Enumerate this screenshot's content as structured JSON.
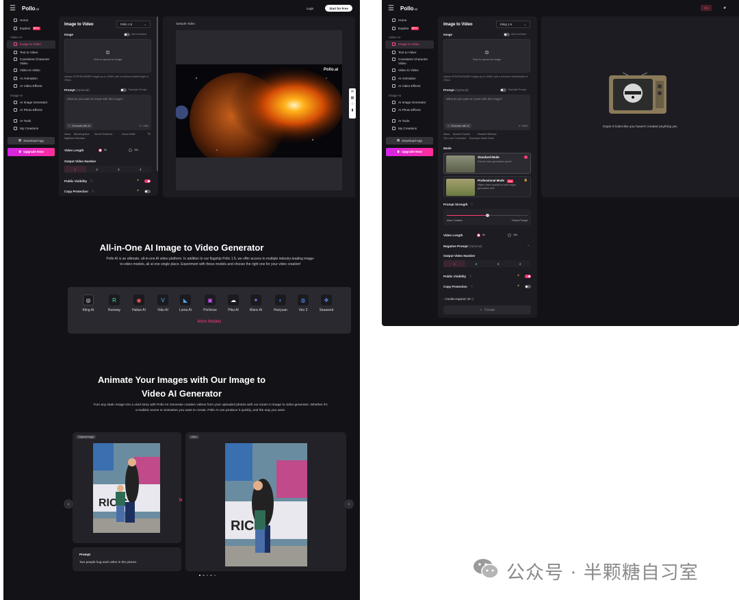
{
  "left": {
    "brand": "Pollo",
    "brand_suffix": ".ai",
    "header": {
      "login": "Login",
      "start": "Start for Free"
    },
    "nav": {
      "home": "Home",
      "explore": "Explore",
      "explore_badge": "BETA",
      "video_ai_section": "Video AI",
      "image_to_video": "Image to Video",
      "text_to_video": "Text to Video",
      "consistent_character": "Consistent Character Video",
      "video_to_video": "Video to Video",
      "ai_animation": "AI Animation",
      "ai_video_effects": "AI Video Effects",
      "image_ai_section": "Image AI",
      "ai_image_generator": "AI Image Generator",
      "ai_photo_effects": "AI Photo Effects",
      "ai_tools": "AI Tools",
      "my_creations": "My Creations",
      "download_app": "Download App",
      "upgrade_now": "Upgrade Now"
    },
    "form": {
      "title": "Image to Video",
      "model": "Pollo 1.5",
      "image_label": "Image",
      "add_end_frame": "Add end frame",
      "upload_text": "Click to upload an image",
      "upload_hint": "Upload JPG/PNG/WEBP images up to 10MB, with a minimum width/height of 300px.",
      "prompt_label": "Prompt",
      "prompt_optional": "(Optional)",
      "translate_prompt": "Translate Prompt",
      "prompt_placeholder": "What do you want to create with this image?",
      "generate_ai": "Generate with AI",
      "char_count": "0 / 1500",
      "tags": [
        "Ideas:",
        "Blooming Bud",
        "Street Performer",
        "Snow Drifter",
        "Nighttime Musician"
      ],
      "video_length_label": "Video Length",
      "length_5": "5s",
      "length_10": "10s",
      "output_number_label": "Output Video Number",
      "outputs": [
        "1",
        "2",
        "3",
        "4"
      ],
      "public_visibility": "Public Visibility",
      "copy_protection": "Copy Protection"
    },
    "sample": {
      "label": "Sample Video",
      "watermark": "Pollo.ai"
    },
    "hero": {
      "title": "All-in-One AI Image to Video Generator",
      "desc": "Pollo AI is an ultimate, all-in-one AI video platform. In addition to our flagship Pollo 1.5, we offer access to multiple industry-leading image-to-video models, all at one single place. Experiment with these models and choose the right one for your video creation!",
      "models": [
        "Kling AI",
        "Runway",
        "Hailuo AI",
        "Vidu AI",
        "Luma AI",
        "PixVerse",
        "Pika AI",
        "Wanx AI",
        "Hunyuan",
        "Veo 2",
        "Seaweed"
      ],
      "model_colors": [
        "#1b1b1f",
        "#1b1b1f",
        "#1b1b1f",
        "#1b1b1f",
        "#1b1b1f",
        "#1b1b1f",
        "#1b1b1f",
        "#1b1b1f",
        "#1b1b1f",
        "#1b1b1f",
        "#1b1b1f"
      ],
      "more_models": "More Models"
    },
    "animate": {
      "title": "Animate Your Images with Our Image to Video AI Generator",
      "desc": "Turn any static image into a vivid story with Pollo AI! Generate creative videos from your uploaded photos with our smart AI image to video generator. Whether it's a realistic scene or animation you want to create, Pollo AI can produce it quickly, and the way you want.",
      "original_label": "Original Image",
      "video_label": "video",
      "prompt_title": "Prompt",
      "prompt_text": "Two people hug each other in the picture."
    }
  },
  "right": {
    "brand": "Pollo",
    "brand_suffix": ".ai",
    "header_badge": "EN",
    "nav": {
      "home": "Home",
      "explore": "Explore",
      "explore_badge": "BETA",
      "video_ai_section": "Video AI",
      "image_to_video": "Image to Video",
      "text_to_video": "Text to Video",
      "consistent_character": "Consistent Character Video",
      "video_to_video": "Video to Video",
      "ai_animation": "AI Animation",
      "ai_video_effects": "AI Video Effects",
      "image_ai_section": "Image AI",
      "ai_image_generator": "AI Image Generator",
      "ai_photo_effects": "AI Photo Effects",
      "ai_tools": "AI Tools",
      "my_creations": "My Creations",
      "download_app": "Download App",
      "upgrade_now": "Upgrade Now"
    },
    "form": {
      "title": "Image to Video",
      "model": "Kling 1.6",
      "image_label": "Image",
      "add_end_frame": "Add end frame",
      "upload_text": "Click to upload an image",
      "upload_hint": "Upload JPG/PNG/WEBP images up to 10MB, with a minimum width/height of 300px.",
      "prompt_label": "Prompt",
      "prompt_optional": "(Optional)",
      "translate_prompt": "Translate Prompt",
      "prompt_placeholder": "What do you want to create with this image?",
      "generate_ai": "Generate with AI",
      "char_count": "0 / 2500",
      "tags": [
        "Ideas:",
        "Ancient Growth",
        "Seaside Stillness",
        "The Lone Commuter",
        "Evening's Urban Rush"
      ],
      "mode_label": "Mode",
      "standard_title": "Standard Mode",
      "standard_desc": "Fast AI video generation speed",
      "pro_title": "Professional Mode",
      "pro_badge": "New",
      "pro_desc": "Higher video quality but with longer generation time",
      "prompt_strength": "Prompt Strength",
      "more_creative": "More Creative",
      "follow_prompt": "Follow Prompt",
      "video_length_label": "Video Length",
      "length_5": "5s",
      "length_10": "10s",
      "negative_prompt": "Negative Prompt",
      "output_number_label": "Output Video Number",
      "outputs": [
        "1",
        "2",
        "3",
        "4"
      ],
      "public_visibility": "Public Visibility",
      "copy_protection": "Copy Protection",
      "credits": "Credits required: 20",
      "create": "Create"
    },
    "empty_text": "Oops! It looks like you haven't created anything yet."
  },
  "watermark": "公众号 · 半颗糖自习室"
}
